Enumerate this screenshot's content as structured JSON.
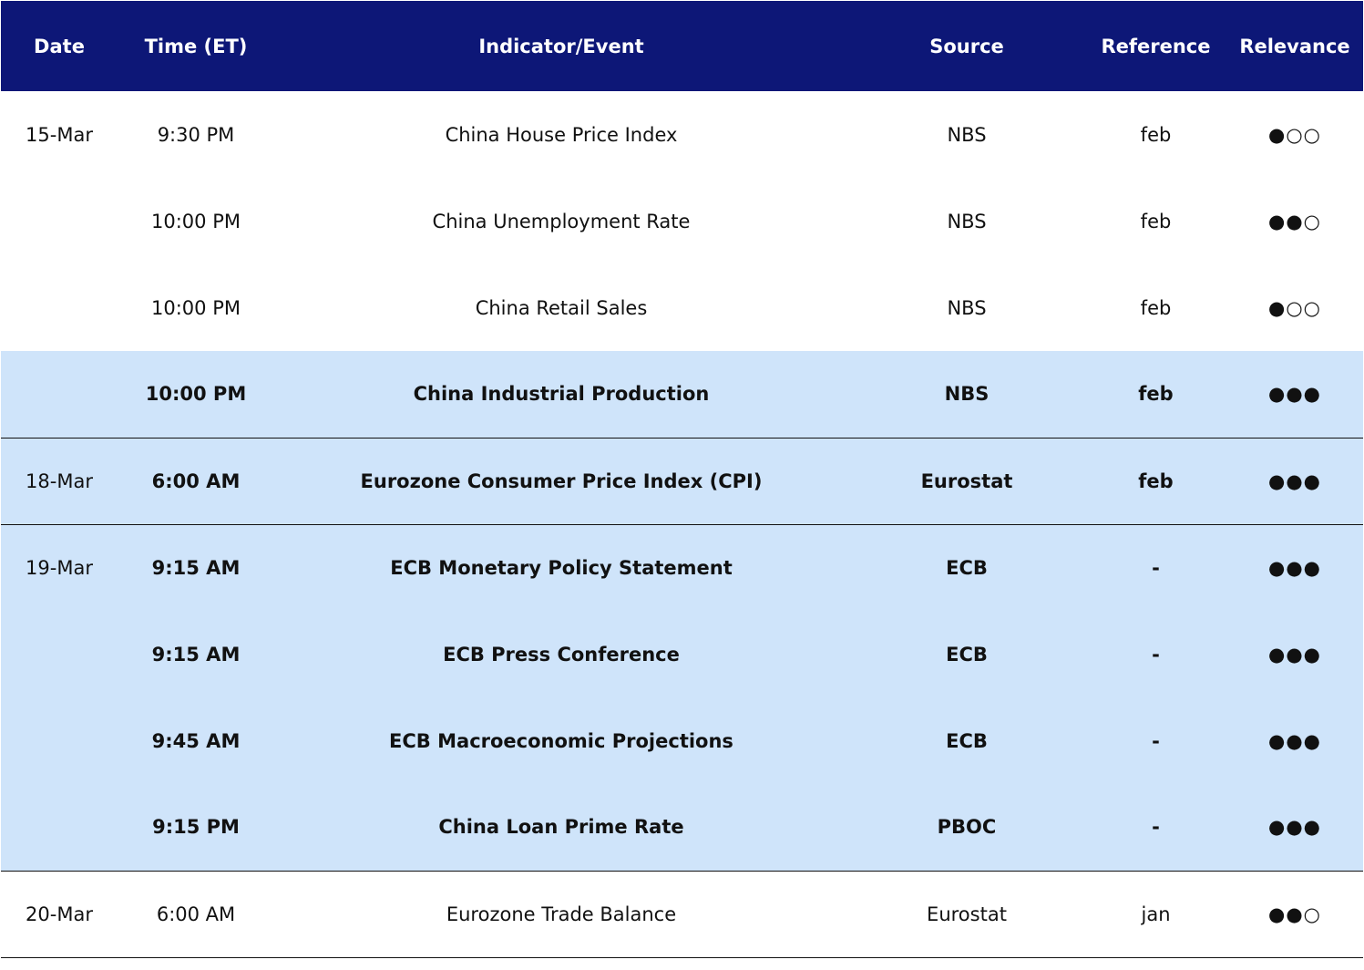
{
  "header": {
    "date": "Date",
    "time": "Time (ET)",
    "indicator": "Indicator/Event",
    "source": "Source",
    "reference": "Reference",
    "relevance": "Relevance"
  },
  "rows": [
    {
      "date": "15-Mar",
      "time": "9:30 PM",
      "indicator": "China House Price Index",
      "source": "NBS",
      "reference": "feb",
      "relevance": "●○○"
    },
    {
      "date": "",
      "time": "10:00 PM",
      "indicator": "China Unemployment Rate",
      "source": "NBS",
      "reference": "feb",
      "relevance": "●●○"
    },
    {
      "date": "",
      "time": "10:00 PM",
      "indicator": "China Retail Sales",
      "source": "NBS",
      "reference": "feb",
      "relevance": "●○○"
    },
    {
      "date": "",
      "time": "10:00 PM",
      "indicator": "China Industrial Production",
      "source": "NBS",
      "reference": "feb",
      "relevance": "●●●"
    },
    {
      "date": "18-Mar",
      "time": "6:00 AM",
      "indicator": "Eurozone Consumer Price Index (CPI)",
      "source": "Eurostat",
      "reference": "feb",
      "relevance": "●●●"
    },
    {
      "date": "19-Mar",
      "time": "9:15 AM",
      "indicator": "ECB Monetary Policy Statement",
      "source": "ECB",
      "reference": "-",
      "relevance": "●●●"
    },
    {
      "date": "",
      "time": "9:15 AM",
      "indicator": "ECB Press Conference",
      "source": "ECB",
      "reference": "-",
      "relevance": "●●●"
    },
    {
      "date": "",
      "time": "9:45 AM",
      "indicator": "ECB Macroeconomic Projections",
      "source": "ECB",
      "reference": "-",
      "relevance": "●●●"
    },
    {
      "date": "",
      "time": "9:15 PM",
      "indicator": "China Loan Prime Rate",
      "source": "PBOC",
      "reference": "-",
      "relevance": "●●●"
    },
    {
      "date": "20-Mar",
      "time": "6:00 AM",
      "indicator": "Eurozone Trade Balance",
      "source": "Eurostat",
      "reference": "jan",
      "relevance": "●●○"
    }
  ],
  "colors": {
    "header_bg": "#0d1777",
    "header_text": "#ffffff",
    "highlight_bg": "#cfe4fa",
    "rule": "#111111"
  }
}
